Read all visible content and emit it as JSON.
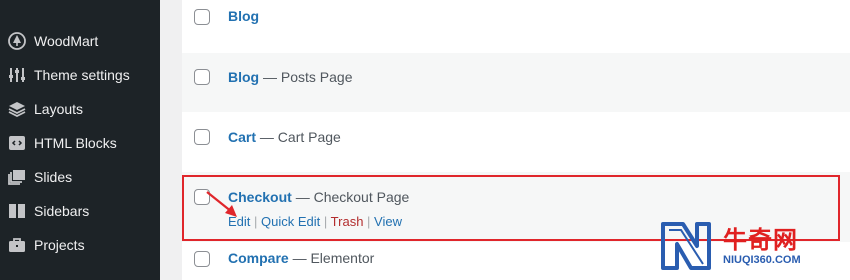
{
  "sidebar": {
    "items": [
      {
        "label": "WoodMart",
        "icon": "tree-icon"
      },
      {
        "label": "Theme settings",
        "icon": "sliders-icon"
      },
      {
        "label": "Layouts",
        "icon": "layers-icon"
      },
      {
        "label": "HTML Blocks",
        "icon": "code-block-icon"
      },
      {
        "label": "Slides",
        "icon": "slides-icon"
      },
      {
        "label": "Sidebars",
        "icon": "sidebar-columns-icon"
      },
      {
        "label": "Projects",
        "icon": "briefcase-icon"
      }
    ]
  },
  "pages": [
    {
      "title": "Blog",
      "suffix": ""
    },
    {
      "title": "Blog",
      "suffix": "Posts Page"
    },
    {
      "title": "Cart",
      "suffix": "Cart Page"
    },
    {
      "title": "Checkout",
      "suffix": "Checkout Page"
    },
    {
      "title": "Compare",
      "suffix": "Elementor"
    }
  ],
  "title_separator": "—",
  "row_actions": {
    "edit": "Edit",
    "quick_edit": "Quick Edit",
    "trash": "Trash",
    "view": "View",
    "divider": "|"
  },
  "watermark": {
    "cn_text": "牛奇网",
    "url_text": "NIUQI360.COM"
  },
  "colors": {
    "sidebar_bg": "#1d2327",
    "link": "#2271b1",
    "trash": "#b32d2e",
    "highlight": "#e0262b"
  }
}
